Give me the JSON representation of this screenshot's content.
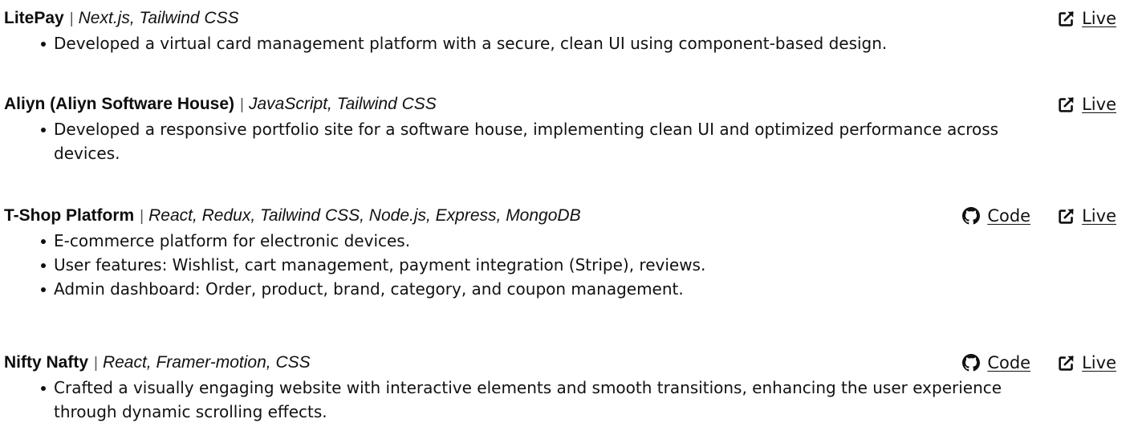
{
  "projects": [
    {
      "name": "LitePay",
      "separator": "|",
      "tech": "Next.js, Tailwind CSS",
      "links": [
        {
          "label": "Live",
          "icon": "external-link-icon"
        }
      ],
      "bullets": [
        "Developed a virtual card management platform with a secure, clean UI using component-based design."
      ]
    },
    {
      "name": "Aliyn (Aliyn Software House)",
      "separator": "|",
      "tech": "JavaScript, Tailwind CSS",
      "links": [
        {
          "label": "Live",
          "icon": "external-link-icon"
        }
      ],
      "bullets": [
        "Developed a responsive portfolio site for a software house, implementing clean UI and optimized performance across devices."
      ]
    },
    {
      "name": "T-Shop Platform",
      "separator": "|",
      "tech": "React, Redux, Tailwind CSS, Node.js, Express, MongoDB",
      "links": [
        {
          "label": "Code",
          "icon": "github-icon"
        },
        {
          "label": "Live",
          "icon": "external-link-icon"
        }
      ],
      "bullets": [
        "E-commerce platform for electronic devices.",
        "User features: Wishlist, cart management, payment integration (Stripe), reviews.",
        "Admin dashboard: Order, product, brand, category, and coupon management."
      ]
    },
    {
      "name": "Nifty Nafty",
      "separator": "|",
      "tech": "React, Framer-motion, CSS",
      "links": [
        {
          "label": "Code",
          "icon": "github-icon"
        },
        {
          "label": "Live",
          "icon": "external-link-icon"
        }
      ],
      "bullets": [
        "Crafted a visually engaging website with interactive elements and smooth transitions, enhancing the user experience through dynamic scrolling effects."
      ]
    }
  ]
}
